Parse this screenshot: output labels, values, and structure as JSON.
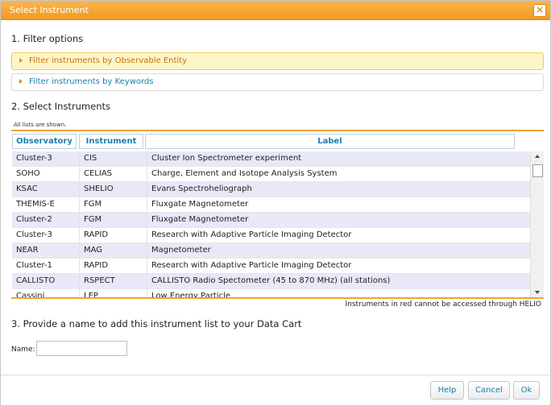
{
  "dialog": {
    "title": "Select Instrument",
    "close_glyph": "×"
  },
  "section1": {
    "title": "1. Filter options",
    "accordion": [
      {
        "label": "Filter instruments by Observable Entity",
        "state": "expanded-highlight"
      },
      {
        "label": "Filter instruments by Keywords",
        "state": "collapsed"
      }
    ]
  },
  "section2": {
    "title": "2. Select Instruments",
    "all_lists_note": "All lists are shown.",
    "columns": [
      "Observatory",
      "Instrument",
      "Label"
    ],
    "rows": [
      {
        "observatory": "Cluster-3",
        "instrument": "CIS",
        "label": "Cluster Ion Spectrometer experiment"
      },
      {
        "observatory": "SOHO",
        "instrument": "CELIAS",
        "label": "Charge, Element and Isotope Analysis System"
      },
      {
        "observatory": "KSAC",
        "instrument": "SHELIO",
        "label": "Evans Spectroheliograph"
      },
      {
        "observatory": "THEMIS-E",
        "instrument": "FGM",
        "label": "Fluxgate Magnetometer"
      },
      {
        "observatory": "Cluster-2",
        "instrument": "FGM",
        "label": "Fluxgate Magnetometer"
      },
      {
        "observatory": "Cluster-3",
        "instrument": "RAPID",
        "label": "Research with Adaptive Particle Imaging Detector"
      },
      {
        "observatory": "NEAR",
        "instrument": "MAG",
        "label": "Magnetometer"
      },
      {
        "observatory": "Cluster-1",
        "instrument": "RAPID",
        "label": "Research with Adaptive Particle Imaging Detector"
      },
      {
        "observatory": "CALLISTO",
        "instrument": "RSPECT",
        "label": "CALLISTO Radio Spectometer (45 to 870 MHz) (all stations)"
      },
      {
        "observatory": "Cassini",
        "instrument": "LEP",
        "label": "Low Energy Particle"
      }
    ],
    "red_note": "Instruments in red cannot be accessed through HELIO"
  },
  "section3": {
    "title": "3. Provide a name to add this instrument list to your Data Cart",
    "name_label": "Name:",
    "name_value": "",
    "name_placeholder": ""
  },
  "buttons": {
    "help": "Help",
    "cancel": "Cancel",
    "ok": "Ok"
  },
  "colors": {
    "titlebar": "#f29a22",
    "link": "#1a7fb0",
    "row_alt": "#e8e8f8",
    "accordion_active_bg": "#fdf5c8"
  },
  "icons": {
    "close": "close-icon",
    "accordion_arrow": "triangle-right-icon",
    "scroll_up": "arrow-up-icon",
    "scroll_down": "arrow-down-icon"
  }
}
